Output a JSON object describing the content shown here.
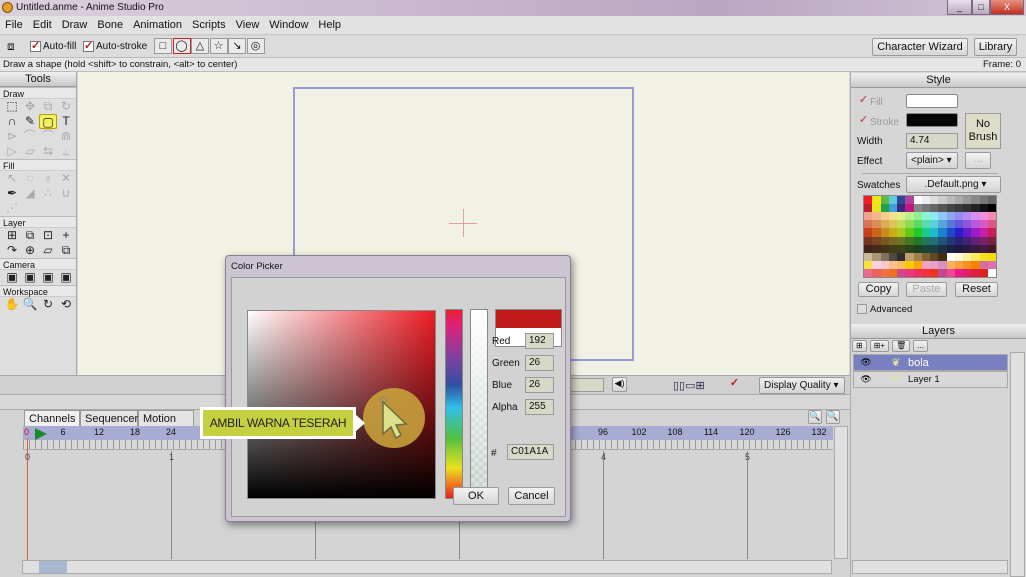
{
  "window": {
    "title": "Untitled.anme - Anime Studio Pro",
    "minimize": "_",
    "maximize": "□",
    "close": "X"
  },
  "menu": [
    "File",
    "Edit",
    "Draw",
    "Bone",
    "Animation",
    "Scripts",
    "View",
    "Window",
    "Help"
  ],
  "toolbar": {
    "auto_fill": "Auto-fill",
    "auto_stroke": "Auto-stroke",
    "shapes": [
      "□",
      "◯",
      "△",
      "☆",
      "↘",
      "◎"
    ],
    "character_wizard": "Character Wizard",
    "library": "Library"
  },
  "status": {
    "hint": "Draw a shape (hold <shift> to constrain, <alt> to center)",
    "frame": "Frame: 0"
  },
  "tools": {
    "title": "Tools",
    "sections": [
      {
        "label": "Draw",
        "rows": [
          [
            "⬚",
            "✥",
            "⧉",
            "↻"
          ],
          [
            "∩",
            "✎",
            "▢",
            "T"
          ],
          [
            "⊳",
            "⌒",
            "⌒",
            "⋒"
          ],
          [
            "▷",
            "▱",
            "⇆",
            "⥿"
          ]
        ]
      },
      {
        "label": "Fill",
        "rows": [
          [
            "↖",
            "◌",
            "♁",
            "✕"
          ],
          [
            "✒",
            "◢",
            "∴",
            "∪"
          ],
          [
            "⋰"
          ]
        ]
      },
      {
        "label": "Layer",
        "rows": [
          [
            "⊞",
            "⧉",
            "⊡",
            "+"
          ],
          [
            "↷",
            "⊕",
            "▱",
            "⧉"
          ]
        ]
      },
      {
        "label": "Camera",
        "rows": [
          [
            "▣",
            "▣",
            "▣",
            "▣"
          ]
        ]
      },
      {
        "label": "Workspace",
        "rows": [
          [
            "✋",
            "🔍",
            "↻",
            "⟲"
          ]
        ]
      }
    ]
  },
  "style": {
    "title": "Style",
    "fill_label": "Fill",
    "stroke_label": "Stroke",
    "width_label": "Width",
    "width_value": "4.74",
    "effect_label": "Effect",
    "effect_value": "<plain>",
    "effect_more": "...",
    "no_brush": "No Brush",
    "swatches_label": "Swatches",
    "swatches_value": ".Default.png",
    "copy": "Copy",
    "paste": "Paste",
    "reset": "Reset",
    "advanced": "Advanced",
    "fill_color": "#ffffff",
    "stroke_color": "#050505"
  },
  "layers": {
    "title": "Layers",
    "toolbar": [
      "⊞",
      "⊞+",
      "🗑",
      "..."
    ],
    "items": [
      {
        "name": "bola",
        "selected": true
      },
      {
        "name": "Layer 1",
        "selected": false
      }
    ]
  },
  "viewbar": {
    "display_quality": "Display Quality"
  },
  "timeline": {
    "tabs": [
      "Channels",
      "Sequencer",
      "Motion Gra"
    ],
    "current_frame": "0",
    "frame_labels": [
      "6",
      "12",
      "18",
      "24",
      "96",
      "102",
      "108",
      "114",
      "120",
      "126",
      "132"
    ],
    "second_labels": [
      "0",
      "1",
      "4",
      "5"
    ]
  },
  "color_picker": {
    "title": "Color Picker",
    "red_label": "Red",
    "red": "192",
    "green_label": "Green",
    "green": "26",
    "blue_label": "Blue",
    "blue": "26",
    "alpha_label": "Alpha",
    "alpha": "255",
    "hash": "#",
    "hex": "C01A1A",
    "ok": "OK",
    "cancel": "Cancel",
    "new_color": "#c01a1a",
    "old_color": "#ffffff"
  },
  "annotation": {
    "callout": "AMBIL WARNA TESERAH"
  }
}
